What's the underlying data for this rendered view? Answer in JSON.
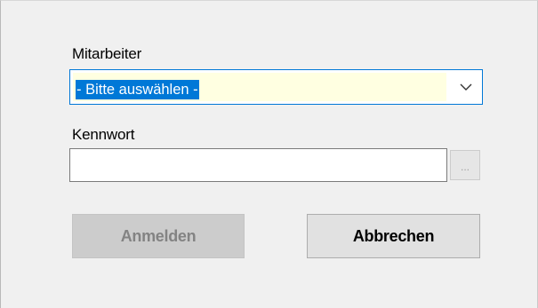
{
  "form": {
    "employee_label": "Mitarbeiter",
    "employee_selected": "- Bitte auswählen -",
    "password_label": "Kennwort",
    "password_value": "",
    "browse_label": "...",
    "login_button": "Anmelden",
    "cancel_button": "Abbrechen"
  },
  "colors": {
    "window_bg": "#f0f0f0",
    "focus_border": "#0078d7",
    "selection_bg": "#0078d7",
    "combo_field_bg": "#ffffe1",
    "disabled_button_bg": "#cccccc",
    "disabled_button_text": "#838383"
  },
  "icons": {
    "combo_arrow": "chevron-down-icon"
  }
}
